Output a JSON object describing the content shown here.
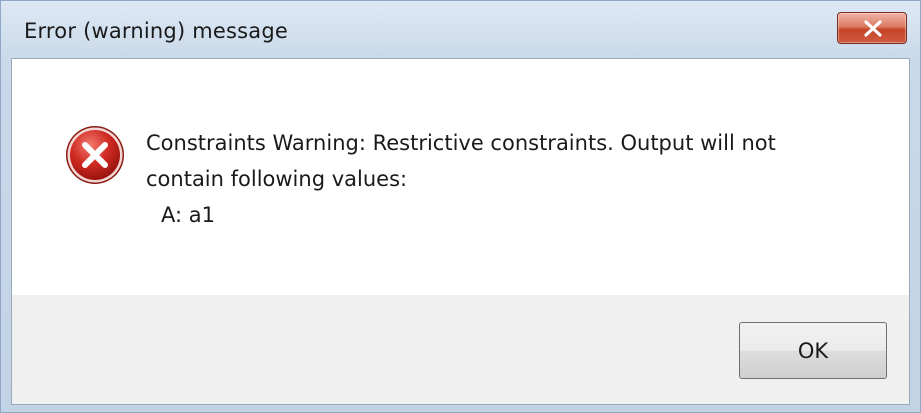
{
  "window": {
    "title": "Error (warning) message",
    "close_icon": "close-x-icon"
  },
  "dialog": {
    "icon": "error-icon",
    "message_lines": [
      "Constraints Warning: Restrictive constraints. Output will not",
      "contain following values:"
    ],
    "value_line": "A: a1",
    "ok_label": "OK"
  },
  "colors": {
    "close_button": "#c5452a",
    "error_icon_red": "#c8201c",
    "button_area": "#f0f0f0"
  }
}
